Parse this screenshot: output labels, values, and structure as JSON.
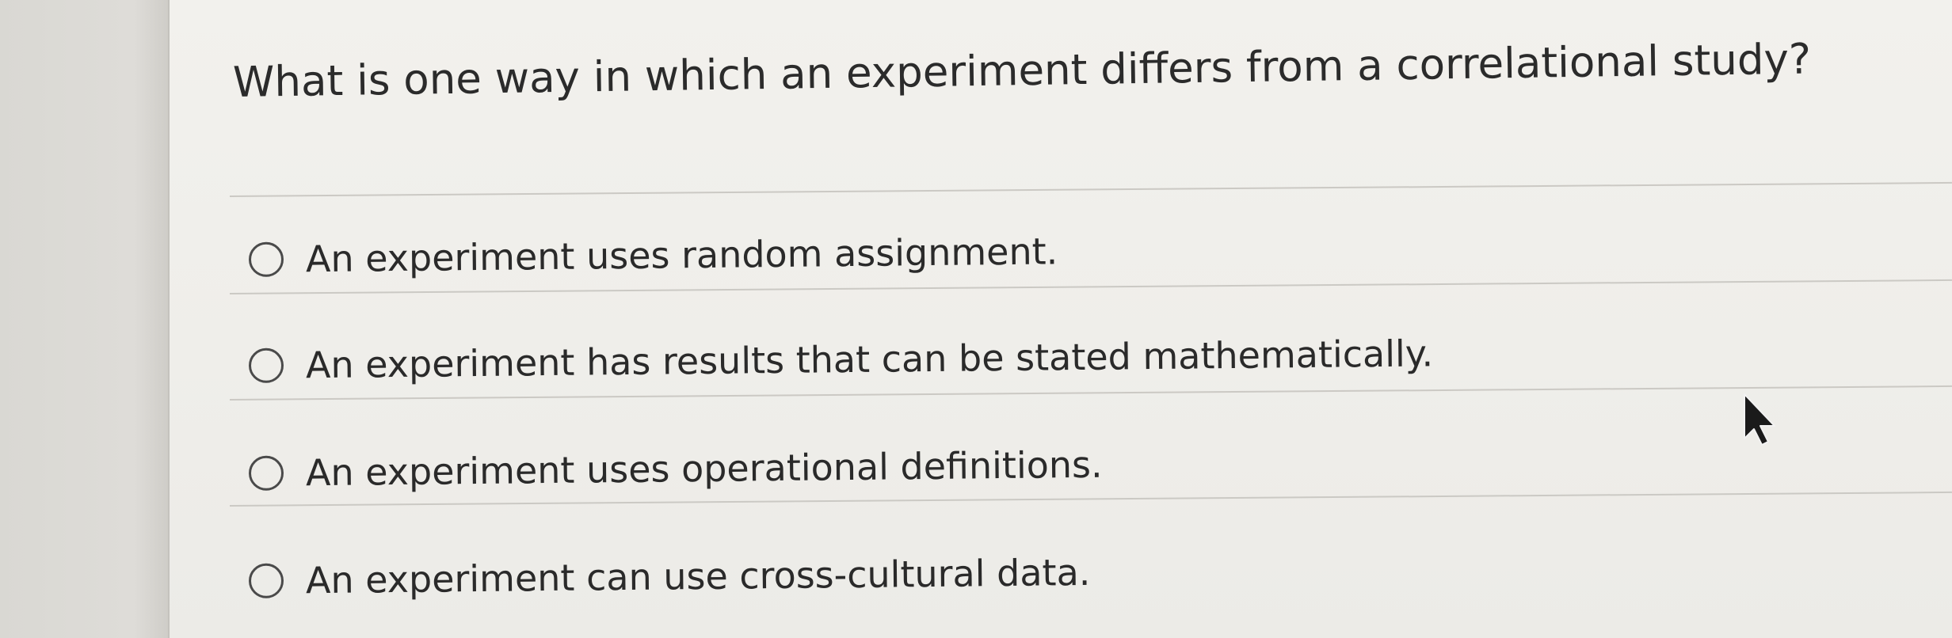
{
  "question": {
    "text": "What is one way in which an experiment differs from a correlational study?"
  },
  "options": [
    {
      "label": "An experiment uses random assignment.",
      "selected": false
    },
    {
      "label": "An experiment has results that can be stated mathematically.",
      "selected": false
    },
    {
      "label": "An experiment uses operational definitions.",
      "selected": false
    },
    {
      "label": "An experiment can use cross-cultural data.",
      "selected": false
    }
  ],
  "icons": {
    "radio": "radio-unselected-icon",
    "pointer": "mouse-pointer-icon"
  },
  "colors": {
    "background": "#efeeea",
    "text": "#2b2b2b",
    "divider": "#cbc9c4"
  }
}
